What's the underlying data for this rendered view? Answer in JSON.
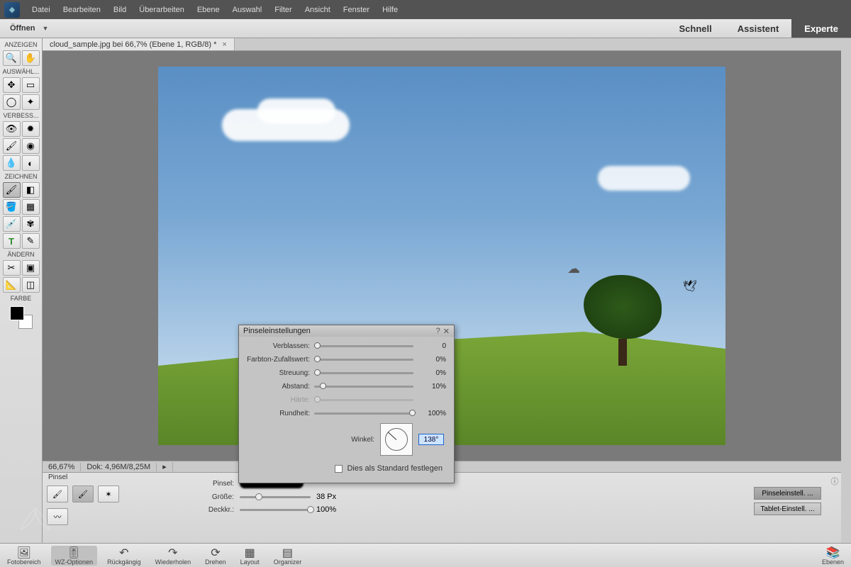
{
  "menu": {
    "items": [
      "Datei",
      "Bearbeiten",
      "Bild",
      "Überarbeiten",
      "Ebene",
      "Auswahl",
      "Filter",
      "Ansicht",
      "Fenster",
      "Hilfe"
    ]
  },
  "modebar": {
    "open": "Öffnen",
    "tabs": [
      "Schnell",
      "Assistent",
      "Experte"
    ],
    "active": "Experte"
  },
  "doc": {
    "tab": "cloud_sample.jpg bei 66,7% (Ebene 1, RGB/8) *"
  },
  "toolbar": {
    "sections": [
      "ANZEIGEN",
      "AUSWÄHL...",
      "VERBESS...",
      "ZEICHNEN",
      "ÄNDERN",
      "FARBE"
    ]
  },
  "status": {
    "zoom": "66,67%",
    "doc": "Dok: 4,96M/8,25M"
  },
  "options": {
    "title": "Pinsel",
    "brush_label": "Pinsel:",
    "size_label": "Größe:",
    "size_val": "38 Px",
    "opacity_label": "Deckkr.:",
    "opacity_val": "100%",
    "btn1": "Pinseleinstell. ...",
    "btn2": "Tablet-Einstell. ..."
  },
  "dialog": {
    "title": "Pinseleinstellungen",
    "rows": [
      {
        "label": "Verblassen:",
        "val": "0",
        "pos": 0
      },
      {
        "label": "Farbton-Zufallswert:",
        "val": "0%",
        "pos": 0
      },
      {
        "label": "Streuung:",
        "val": "0%",
        "pos": 0
      },
      {
        "label": "Abstand:",
        "val": "10%",
        "pos": 10
      },
      {
        "label": "Härte:",
        "val": "",
        "pos": 0,
        "disabled": true
      },
      {
        "label": "Rundheit:",
        "val": "100%",
        "pos": 100
      }
    ],
    "angle_label": "Winkel:",
    "angle_val": "138°",
    "default_label": "Dies als Standard festlegen"
  },
  "bottom": {
    "items": [
      {
        "label": "Fotobereich",
        "active": false
      },
      {
        "label": "WZ-Optionen",
        "active": true
      },
      {
        "label": "Rückgängig",
        "active": false
      },
      {
        "label": "Wiederholen",
        "active": false
      },
      {
        "label": "Drehen",
        "active": false
      },
      {
        "label": "Layout",
        "active": false
      },
      {
        "label": "Organizer",
        "active": false
      }
    ],
    "layers": "Ebenen"
  }
}
